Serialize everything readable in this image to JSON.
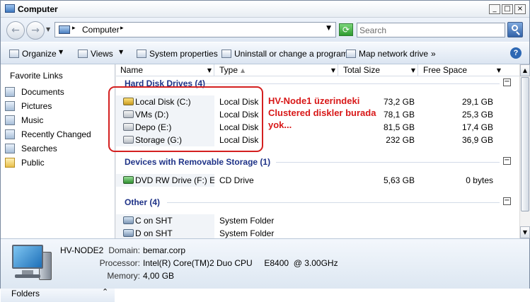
{
  "window": {
    "title": "Computer",
    "controls": [
      "_",
      "□",
      "×"
    ]
  },
  "address": {
    "location": "Computer",
    "search_placeholder": "Search"
  },
  "toolbar": {
    "organize": "Organize",
    "views": "Views",
    "system_properties": "System properties",
    "uninstall": "Uninstall or change a program",
    "map_network": "Map network drive",
    "more": "»",
    "help": "?"
  },
  "nav": {
    "heading": "Favorite Links",
    "items": [
      {
        "label": "Documents",
        "icon": "documents-icon"
      },
      {
        "label": "Pictures",
        "icon": "pictures-icon"
      },
      {
        "label": "Music",
        "icon": "music-icon"
      },
      {
        "label": "Recently Changed",
        "icon": "recently-changed-icon"
      },
      {
        "label": "Searches",
        "icon": "searches-icon"
      },
      {
        "label": "Public",
        "icon": "public-folder-icon"
      }
    ],
    "folders": "Folders"
  },
  "columns": {
    "name": "Name",
    "type": "Type",
    "total_size": "Total Size",
    "free_space": "Free Space"
  },
  "groups": [
    {
      "title": "Hard Disk Drives (4)",
      "rows": [
        {
          "name": "Local Disk (C:)",
          "type": "Local Disk",
          "total": "73,2 GB",
          "free": "29,1 GB",
          "icon": "system-drive-icon"
        },
        {
          "name": "VMs (D:)",
          "type": "Local Disk",
          "total": "78,1 GB",
          "free": "25,3 GB",
          "icon": "hard-drive-icon"
        },
        {
          "name": "Depo (E:)",
          "type": "Local Disk",
          "total": "81,5 GB",
          "free": "17,4 GB",
          "icon": "hard-drive-icon"
        },
        {
          "name": "Storage (G:)",
          "type": "Local Disk",
          "total": "232 GB",
          "free": "36,9 GB",
          "icon": "hard-drive-icon"
        }
      ]
    },
    {
      "title": "Devices with Removable Storage (1)",
      "rows": [
        {
          "name": "DVD RW Drive (F:) E...",
          "type": "CD Drive",
          "total": "5,63 GB",
          "free": "0 bytes",
          "icon": "dvd-drive-icon"
        }
      ]
    },
    {
      "title": "Other (4)",
      "rows": [
        {
          "name": "C on SHT",
          "type": "System Folder",
          "total": "",
          "free": "",
          "icon": "network-share-icon"
        },
        {
          "name": "D on SHT",
          "type": "System Folder",
          "total": "",
          "free": "",
          "icon": "network-share-icon"
        }
      ]
    }
  ],
  "annotation": {
    "lines": [
      "HV-Node1 üzerindeki",
      "Clustered diskler burada",
      "yok..."
    ],
    "color": "#d81818"
  },
  "details": {
    "computer_name": "HV-NODE2",
    "domain_label": "Domain:",
    "domain_value": "bemar.corp",
    "processor_label": "Processor:",
    "processor_value": "Intel(R) Core(TM)2 Duo CPU     E8400  @ 3.00GHz",
    "memory_label": "Memory:",
    "memory_value": "4,00 GB"
  }
}
